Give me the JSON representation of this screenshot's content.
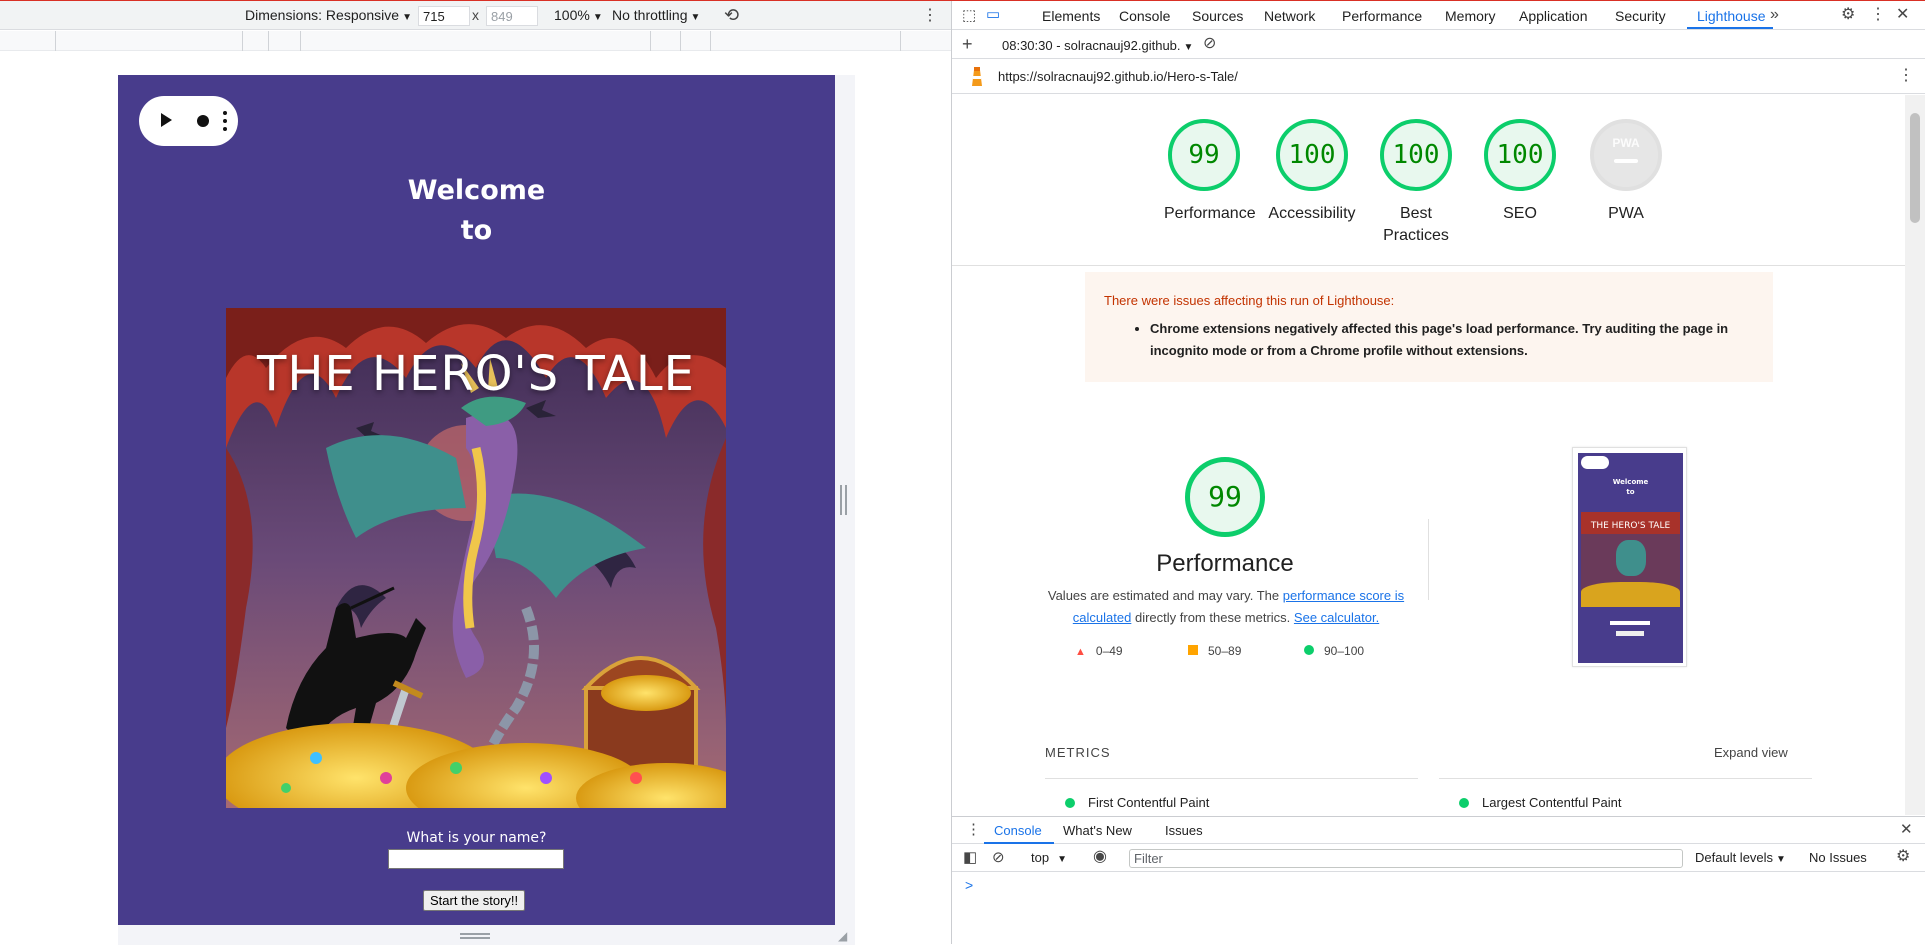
{
  "device_toolbar": {
    "dimensions_label": "Dimensions: Responsive",
    "width": "715",
    "times": "x",
    "height": "849",
    "zoom": "100%",
    "throttling": "No throttling"
  },
  "page": {
    "welcome_line1": "Welcome",
    "welcome_line2": "to",
    "hero_title": "THE HERO'S TALE",
    "name_question": "What is your name?",
    "start_button": "Start the story!!",
    "background_color": "#483c8c"
  },
  "devtools": {
    "tabs": [
      "Elements",
      "Console",
      "Sources",
      "Network",
      "Performance",
      "Memory",
      "Application",
      "Security",
      "Lighthouse"
    ],
    "active_tab": "Lighthouse",
    "more_tabs_icon": "chevrons-right-icon",
    "report_time": "08:30:30 - solracnauj92.github.",
    "url": "https://solracnauj92.github.io/Hero-s-Tale/"
  },
  "lighthouse": {
    "scores": [
      {
        "value": "99",
        "label": "Performance"
      },
      {
        "value": "100",
        "label": "Accessibility"
      },
      {
        "value": "100",
        "label": "Best Practices"
      },
      {
        "value": "100",
        "label": "SEO"
      },
      {
        "value": "PWA",
        "label": "PWA"
      }
    ],
    "warning_title": "There were issues affecting this run of Lighthouse:",
    "warning_item": "Chrome extensions negatively affected this page's load performance. Try auditing the page in incognito mode or from a Chrome profile without extensions.",
    "perf_score": "99",
    "perf_title": "Performance",
    "perf_desc_prefix": "Values are estimated and may vary. The",
    "perf_link1": "performance score is calculated",
    "perf_desc_mid": "directly from these metrics.",
    "perf_link2": "See calculator.",
    "legend": [
      "0–49",
      "50–89",
      "90–100"
    ],
    "metrics_label": "METRICS",
    "expand_label": "Expand view",
    "metric1": "First Contentful Paint",
    "metric2": "Largest Contentful Paint",
    "thumb_welcome1": "Welcome",
    "thumb_welcome2": "to",
    "thumb_title": "THE HERO'S TALE",
    "colors": {
      "pass": "#0cce6b",
      "average": "#ffa400",
      "fail": "#ff4e42"
    }
  },
  "console_drawer": {
    "tabs": [
      "Console",
      "What's New",
      "Issues"
    ],
    "context": "top",
    "filter_placeholder": "Filter",
    "levels": "Default levels",
    "issues": "No Issues",
    "prompt": ">"
  }
}
